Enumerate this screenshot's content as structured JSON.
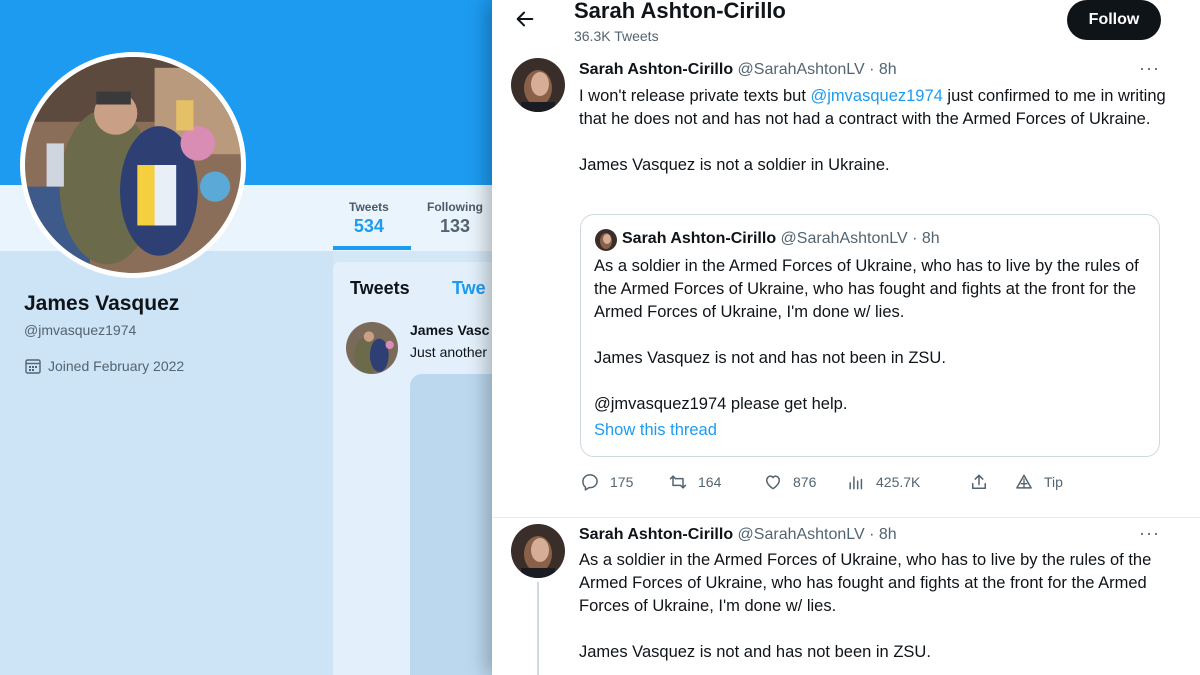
{
  "profile": {
    "stats": [
      {
        "label": "Tweets",
        "value": "534"
      },
      {
        "label": "Following",
        "value": "133"
      }
    ],
    "name": "James Vasquez",
    "handle": "@jmvasquez1974",
    "joined": "Joined February 2022",
    "tabs": {
      "tweets": "Tweets",
      "replies_partial": "Twe"
    },
    "latest_tweet": {
      "name": "James Vasc",
      "text": "Just another"
    }
  },
  "header": {
    "name": "Sarah Ashton-Cirillo",
    "tweet_count": "36.3K Tweets",
    "follow_label": "Follow"
  },
  "main_tweet": {
    "author_name": "Sarah Ashton-Cirillo",
    "meta": "@SarahAshtonLV · 8h",
    "more": "···",
    "line1_pre": "I won't release private texts but ",
    "line1_mention": "@jmvasquez1974",
    "line1_post": " just confirmed to me in writing that he does not and has not had a contract with the Armed Forces of Ukraine.",
    "line2": "James Vasquez is not a soldier in Ukraine.",
    "quote": {
      "author_name": "Sarah Ashton-Cirillo",
      "meta": "@SarahAshtonLV · 8h",
      "para1": "As a soldier in the Armed Forces of Ukraine, who has to live by the rules of the Armed Forces of Ukraine, who has fought and fights at the front for the Armed Forces of Ukraine, I'm done w/ lies.",
      "para2": "James Vasquez is not and has not been in ZSU.",
      "para3": "@jmvasquez1974 please get help.",
      "show_thread": "Show this thread"
    },
    "actions": {
      "replies": "175",
      "retweets": "164",
      "likes": "876",
      "views": "425.7K",
      "tip": "Tip"
    }
  },
  "second_tweet": {
    "author_name": "Sarah Ashton-Cirillo",
    "meta": "@SarahAshtonLV · 8h",
    "more": "···",
    "para1": "As a soldier in the Armed Forces of Ukraine, who has to live by the rules of the Armed Forces of Ukraine, who has fought and fights at the front for the Armed Forces of Ukraine, I'm done w/ lies.",
    "para2": "James Vasquez is not and has not been in ZSU."
  },
  "colors": {
    "accent": "#1d9bf0",
    "text": "#0f1419",
    "muted": "#536471",
    "follow_bg": "#0f1419"
  }
}
